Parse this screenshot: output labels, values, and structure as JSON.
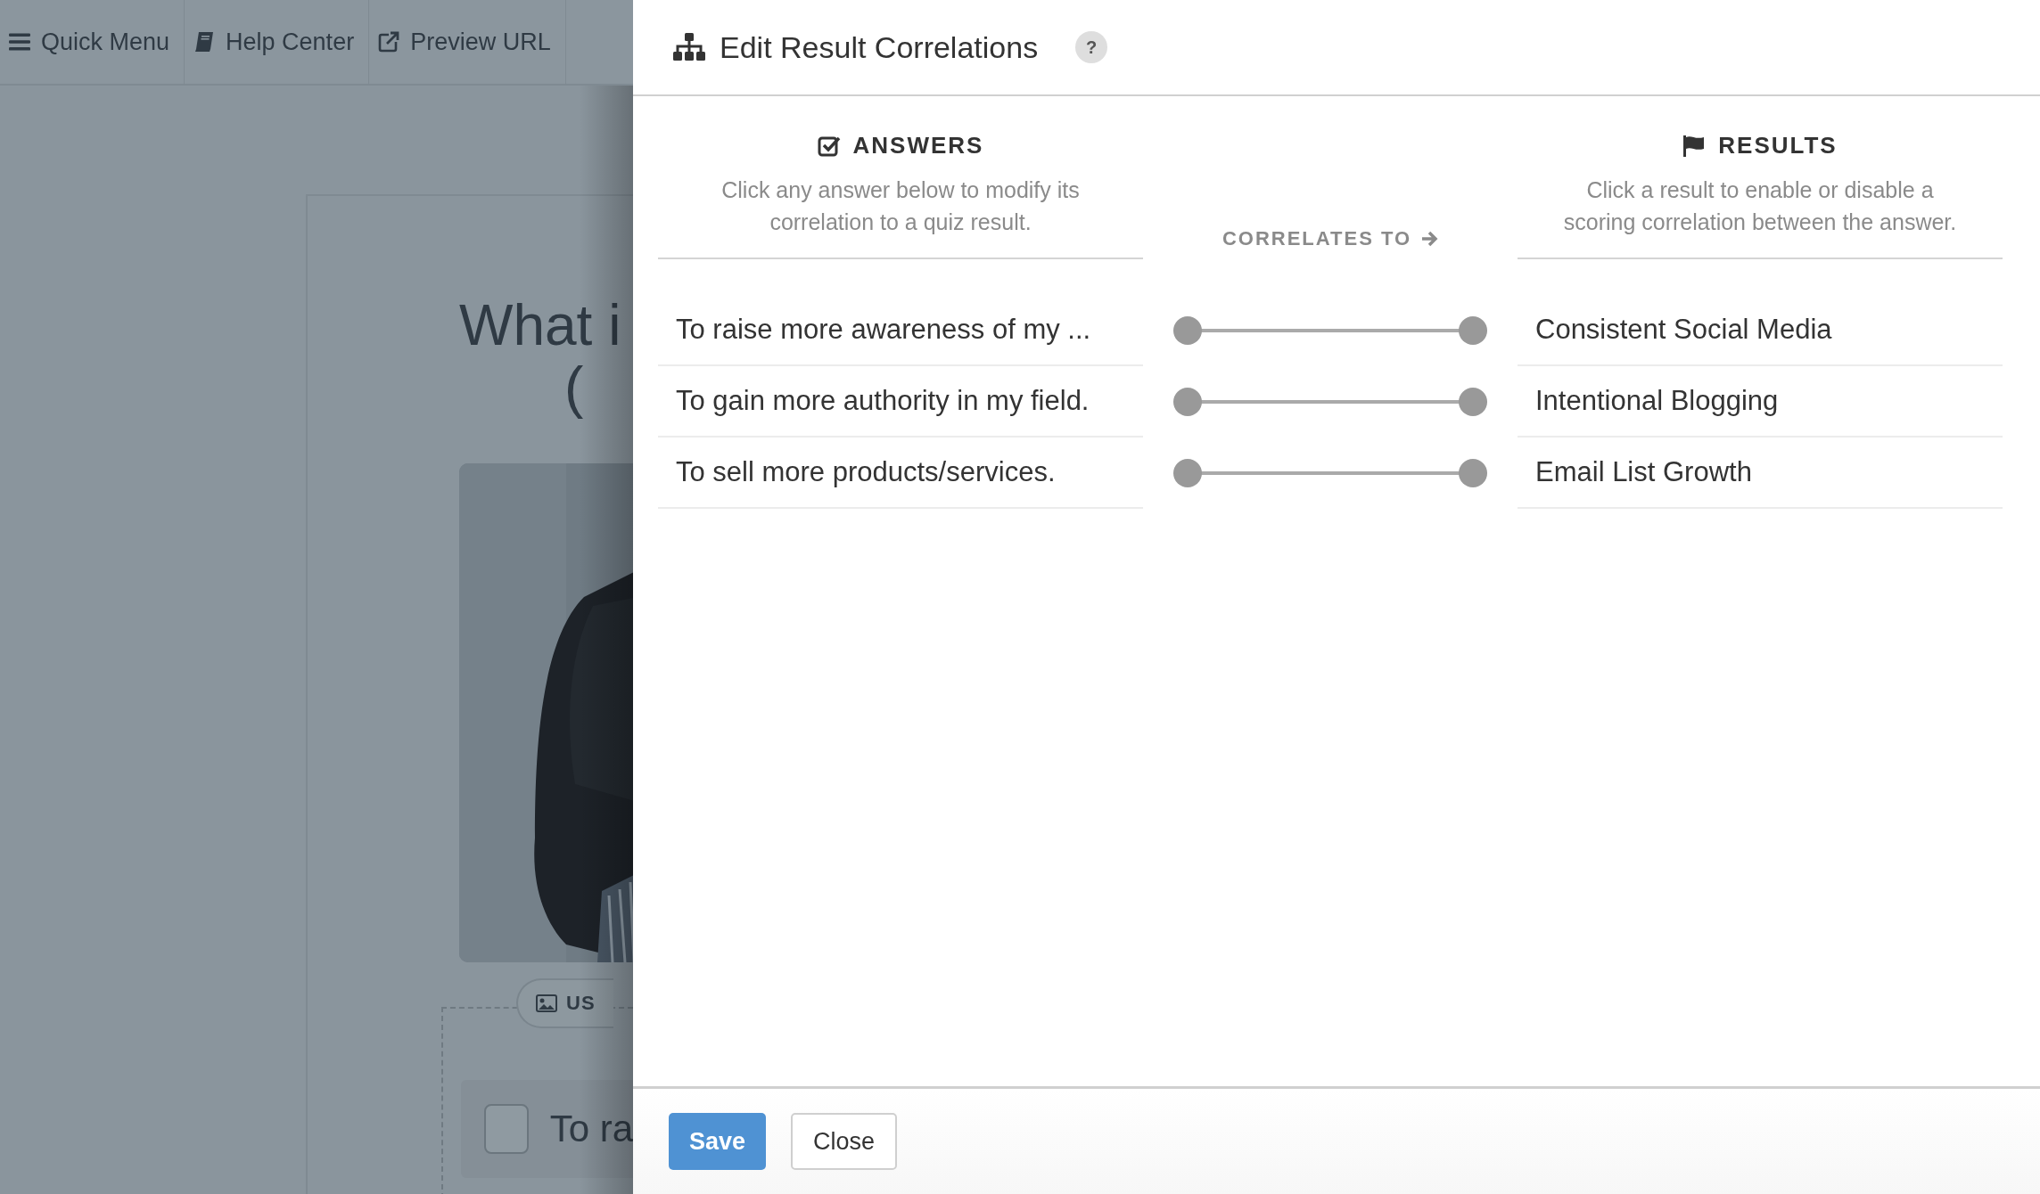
{
  "toolbar": {
    "items": [
      {
        "kind": "menu",
        "label": "Quick Menu"
      },
      {
        "kind": "help",
        "label": "Help Center"
      },
      {
        "kind": "external",
        "label": "Preview URL"
      }
    ]
  },
  "background_page": {
    "question_title": [
      "What i",
      "("
    ],
    "image": {
      "kind": "picture"
    },
    "image_button": "US",
    "answer_option": {
      "label": "To ra",
      "checked": false
    }
  },
  "dialog": {
    "title": "Edit Result Correlations",
    "help": "?",
    "answers_column": {
      "heading": "ANSWERS",
      "description": "Click any answer below to modify its correlation to a quiz result."
    },
    "middle_label": "CORRELATES TO",
    "results_column": {
      "heading": "RESULTS",
      "description": "Click a result to enable or disable a scoring correlation between the answer."
    },
    "rows": [
      {
        "answer": "To raise more awareness of my ...",
        "result": "Consistent Social Media"
      },
      {
        "answer": "To gain more authority in my field.",
        "result": "Intentional Blogging"
      },
      {
        "answer": "To sell more products/services.",
        "result": "Email List Growth"
      }
    ],
    "buttons": [
      {
        "kind": "primary",
        "label": "Save"
      },
      {
        "kind": "secondary",
        "label": "Close"
      }
    ]
  }
}
